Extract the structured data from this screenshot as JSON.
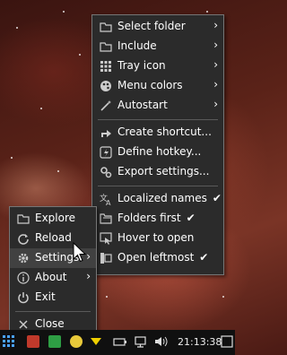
{
  "main_menu": {
    "items": [
      {
        "label": "Select folder",
        "icon": "folder-icon"
      },
      {
        "label": "Include",
        "icon": "folder-icon"
      },
      {
        "label": "Tray icon",
        "icon": "grid-icon"
      },
      {
        "label": "Menu colors",
        "icon": "palette-icon"
      },
      {
        "label": "Autostart",
        "icon": "wand-icon"
      },
      {
        "label": "Create shortcut...",
        "icon": "shortcut-icon"
      },
      {
        "label": "Define hotkey...",
        "icon": "hotkey-icon"
      },
      {
        "label": "Export settings...",
        "icon": "gears-icon"
      },
      {
        "label": "Localized names",
        "icon": "translate-icon",
        "check": "✔"
      },
      {
        "label": "Folders first",
        "icon": "folders-icon",
        "check": "✔"
      },
      {
        "label": "Hover to open",
        "icon": "hover-icon"
      },
      {
        "label": "Open leftmost",
        "icon": "leftmost-icon",
        "check": "✔"
      }
    ]
  },
  "tray_menu": {
    "items": [
      {
        "label": "Explore",
        "icon": "folder-icon"
      },
      {
        "label": "Reload",
        "icon": "reload-icon"
      },
      {
        "label": "Settings",
        "icon": "gear-icon"
      },
      {
        "label": "About",
        "icon": "info-icon"
      },
      {
        "label": "Exit",
        "icon": "power-icon"
      },
      {
        "label": "Close",
        "icon": "close-icon"
      }
    ]
  },
  "taskbar": {
    "clock": "21:13:38"
  }
}
